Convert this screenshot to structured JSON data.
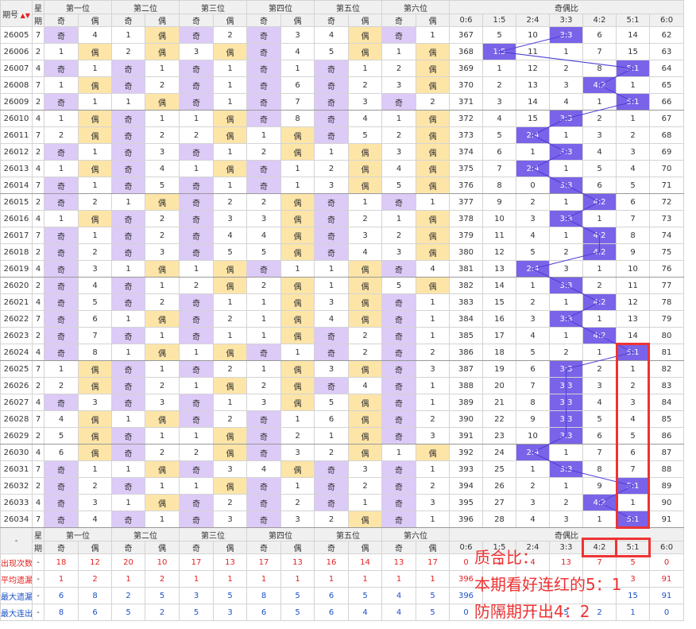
{
  "chart_data": {
    "type": "table",
    "header": {
      "issue": "期号",
      "week": [
        "星",
        "期"
      ],
      "positions": [
        "第一位",
        "第二位",
        "第三位",
        "第四位",
        "第五位",
        "第六位"
      ],
      "odd": "奇",
      "even": "偶",
      "ratio_group": "奇偶比",
      "ratios": [
        "0:6",
        "1:5",
        "2:4",
        "3:3",
        "4:2",
        "5:1",
        "6:0"
      ]
    },
    "rows": [
      {
        "issue": "26005",
        "week": "7",
        "pos": [
          "O",
          "E",
          "O",
          "O",
          "E",
          "O"
        ],
        "omit": [
          4,
          1,
          2,
          3,
          4,
          1
        ],
        "ratio": "3:3",
        "rmiss": [
          367,
          5,
          10,
          0,
          6,
          14,
          62
        ]
      },
      {
        "issue": "26006",
        "week": "2",
        "pos": [
          "E",
          "E",
          "E",
          "O",
          "E",
          "E"
        ],
        "omit": [
          1,
          2,
          3,
          4,
          5,
          1
        ],
        "ratio": "1:5",
        "rmiss": [
          368,
          0,
          11,
          1,
          7,
          15,
          63
        ]
      },
      {
        "issue": "26007",
        "week": "4",
        "pos": [
          "O",
          "O",
          "O",
          "O",
          "O",
          "E"
        ],
        "omit": [
          1,
          1,
          1,
          1,
          1,
          2
        ],
        "ratio": "5:1",
        "rmiss": [
          369,
          1,
          12,
          2,
          8,
          0,
          64
        ]
      },
      {
        "issue": "26008",
        "week": "7",
        "pos": [
          "E",
          "O",
          "O",
          "O",
          "O",
          "E"
        ],
        "omit": [
          1,
          2,
          1,
          6,
          2,
          3
        ],
        "ratio": "4:2",
        "rmiss": [
          370,
          2,
          13,
          3,
          0,
          1,
          65
        ]
      },
      {
        "issue": "26009",
        "week": "2",
        "pos": [
          "O",
          "E",
          "O",
          "O",
          "O",
          "O"
        ],
        "omit": [
          1,
          1,
          1,
          7,
          3,
          2
        ],
        "ratio": "5:1",
        "rmiss": [
          371,
          3,
          14,
          4,
          1,
          0,
          66
        ]
      },
      {
        "issue": "26010",
        "week": "4",
        "pos": [
          "E",
          "O",
          "E",
          "O",
          "O",
          "E"
        ],
        "omit": [
          1,
          1,
          1,
          8,
          4,
          1
        ],
        "ratio": "3:3",
        "rmiss": [
          372,
          4,
          15,
          0,
          2,
          1,
          67
        ]
      },
      {
        "issue": "26011",
        "week": "7",
        "pos": [
          "E",
          "O",
          "E",
          "E",
          "O",
          "E"
        ],
        "omit": [
          2,
          2,
          2,
          1,
          5,
          2
        ],
        "ratio": "2:4",
        "rmiss": [
          373,
          5,
          0,
          1,
          3,
          2,
          68
        ]
      },
      {
        "issue": "26012",
        "week": "2",
        "pos": [
          "O",
          "O",
          "O",
          "E",
          "E",
          "E"
        ],
        "omit": [
          1,
          3,
          1,
          2,
          1,
          3
        ],
        "ratio": "3:3",
        "rmiss": [
          374,
          6,
          1,
          0,
          4,
          3,
          69
        ]
      },
      {
        "issue": "26013",
        "week": "4",
        "pos": [
          "E",
          "O",
          "E",
          "O",
          "E",
          "E"
        ],
        "omit": [
          1,
          4,
          1,
          1,
          2,
          4
        ],
        "ratio": "2:4",
        "rmiss": [
          375,
          7,
          0,
          1,
          5,
          4,
          70
        ]
      },
      {
        "issue": "26014",
        "week": "7",
        "pos": [
          "O",
          "O",
          "O",
          "O",
          "E",
          "E"
        ],
        "omit": [
          1,
          5,
          1,
          1,
          3,
          5
        ],
        "ratio": "3:3",
        "rmiss": [
          376,
          8,
          0,
          1,
          6,
          5,
          71
        ]
      },
      {
        "issue": "26015",
        "week": "2",
        "pos": [
          "O",
          "E",
          "O",
          "E",
          "O",
          "O"
        ],
        "omit": [
          2,
          1,
          2,
          2,
          1,
          1
        ],
        "ratio": "4:2",
        "rmiss": [
          377,
          9,
          2,
          1,
          0,
          6,
          72
        ]
      },
      {
        "issue": "26016",
        "week": "4",
        "pos": [
          "E",
          "O",
          "O",
          "E",
          "O",
          "E"
        ],
        "omit": [
          1,
          2,
          3,
          3,
          2,
          1
        ],
        "ratio": "3:3",
        "rmiss": [
          378,
          10,
          3,
          0,
          1,
          7,
          73
        ]
      },
      {
        "issue": "26017",
        "week": "7",
        "pos": [
          "O",
          "O",
          "O",
          "E",
          "O",
          "E"
        ],
        "omit": [
          1,
          2,
          4,
          4,
          3,
          2
        ],
        "ratio": "4:2",
        "rmiss": [
          379,
          11,
          4,
          1,
          0,
          8,
          74
        ]
      },
      {
        "issue": "26018",
        "week": "2",
        "pos": [
          "O",
          "O",
          "O",
          "E",
          "O",
          "E"
        ],
        "omit": [
          2,
          3,
          5,
          5,
          4,
          3
        ],
        "ratio": "4:2",
        "rmiss": [
          380,
          12,
          5,
          2,
          0,
          9,
          75
        ]
      },
      {
        "issue": "26019",
        "week": "4",
        "pos": [
          "O",
          "E",
          "E",
          "O",
          "E",
          "O"
        ],
        "omit": [
          3,
          1,
          1,
          1,
          1,
          4
        ],
        "ratio": "2:4",
        "rmiss": [
          381,
          13,
          0,
          3,
          1,
          10,
          76
        ]
      },
      {
        "issue": "26020",
        "week": "2",
        "pos": [
          "O",
          "O",
          "E",
          "E",
          "E",
          "E"
        ],
        "omit": [
          4,
          1,
          2,
          2,
          1,
          5
        ],
        "ratio": "3:3",
        "rmiss": [
          382,
          14,
          1,
          0,
          2,
          11,
          77
        ]
      },
      {
        "issue": "26021",
        "week": "4",
        "pos": [
          "O",
          "O",
          "O",
          "E",
          "E",
          "O"
        ],
        "omit": [
          5,
          2,
          1,
          1,
          3,
          1
        ],
        "ratio": "4:2",
        "rmiss": [
          383,
          15,
          2,
          1,
          0,
          12,
          78
        ]
      },
      {
        "issue": "26022",
        "week": "7",
        "pos": [
          "O",
          "E",
          "O",
          "E",
          "E",
          "O"
        ],
        "omit": [
          6,
          1,
          2,
          1,
          4,
          1
        ],
        "ratio": "3:3",
        "rmiss": [
          384,
          16,
          3,
          0,
          1,
          13,
          79
        ]
      },
      {
        "issue": "26023",
        "week": "2",
        "pos": [
          "O",
          "O",
          "O",
          "E",
          "O",
          "O"
        ],
        "omit": [
          7,
          1,
          1,
          1,
          2,
          1
        ],
        "ratio": "4:2",
        "rmiss": [
          385,
          17,
          4,
          1,
          0,
          14,
          80
        ]
      },
      {
        "issue": "26024",
        "week": "4",
        "pos": [
          "O",
          "E",
          "E",
          "O",
          "O",
          "O"
        ],
        "omit": [
          8,
          1,
          1,
          1,
          2,
          2
        ],
        "ratio": "5:1",
        "rmiss": [
          386,
          18,
          5,
          2,
          1,
          0,
          81
        ]
      },
      {
        "issue": "26025",
        "week": "7",
        "pos": [
          "E",
          "O",
          "O",
          "E",
          "E",
          "O"
        ],
        "omit": [
          1,
          1,
          2,
          1,
          3,
          3
        ],
        "ratio": "3:3",
        "rmiss": [
          387,
          19,
          6,
          0,
          2,
          1,
          82
        ]
      },
      {
        "issue": "26026",
        "week": "2",
        "pos": [
          "E",
          "O",
          "E",
          "E",
          "O",
          "O"
        ],
        "omit": [
          2,
          2,
          1,
          2,
          4,
          1
        ],
        "ratio": "3:3",
        "rmiss": [
          388,
          20,
          7,
          0,
          3,
          2,
          83
        ]
      },
      {
        "issue": "26027",
        "week": "4",
        "pos": [
          "O",
          "O",
          "O",
          "E",
          "E",
          "O"
        ],
        "omit": [
          3,
          3,
          1,
          3,
          5,
          1
        ],
        "ratio": "3:3",
        "rmiss": [
          389,
          21,
          8,
          0,
          4,
          3,
          84
        ]
      },
      {
        "issue": "26028",
        "week": "7",
        "pos": [
          "E",
          "E",
          "O",
          "O",
          "E",
          "O"
        ],
        "omit": [
          4,
          1,
          2,
          1,
          6,
          2
        ],
        "ratio": "3:3",
        "rmiss": [
          390,
          22,
          9,
          0,
          5,
          4,
          85
        ]
      },
      {
        "issue": "26029",
        "week": "2",
        "pos": [
          "E",
          "O",
          "E",
          "O",
          "E",
          "O"
        ],
        "omit": [
          5,
          1,
          1,
          2,
          1,
          3
        ],
        "ratio": "3:3",
        "rmiss": [
          391,
          23,
          10,
          0,
          6,
          5,
          86
        ]
      },
      {
        "issue": "26030",
        "week": "4",
        "pos": [
          "E",
          "O",
          "E",
          "O",
          "E",
          "E"
        ],
        "omit": [
          6,
          2,
          2,
          3,
          2,
          1
        ],
        "ratio": "2:4",
        "rmiss": [
          392,
          24,
          0,
          1,
          7,
          6,
          87
        ]
      },
      {
        "issue": "26031",
        "week": "7",
        "pos": [
          "O",
          "E",
          "O",
          "E",
          "O",
          "O"
        ],
        "omit": [
          1,
          1,
          3,
          4,
          3,
          1
        ],
        "ratio": "3:3",
        "rmiss": [
          393,
          25,
          1,
          0,
          8,
          7,
          88
        ]
      },
      {
        "issue": "26032",
        "week": "2",
        "pos": [
          "O",
          "O",
          "E",
          "O",
          "O",
          "O"
        ],
        "omit": [
          2,
          1,
          1,
          1,
          2,
          2
        ],
        "ratio": "5:1",
        "rmiss": [
          394,
          26,
          2,
          1,
          9,
          0,
          89
        ]
      },
      {
        "issue": "26033",
        "week": "4",
        "pos": [
          "O",
          "E",
          "O",
          "O",
          "O",
          "O"
        ],
        "omit": [
          3,
          1,
          2,
          2,
          1,
          3
        ],
        "ratio": "4:2",
        "rmiss": [
          395,
          27,
          3,
          2,
          0,
          1,
          90
        ]
      },
      {
        "issue": "26034",
        "week": "7",
        "pos": [
          "O",
          "O",
          "O",
          "O",
          "E",
          "O"
        ],
        "omit": [
          4,
          1,
          3,
          3,
          2,
          1
        ],
        "ratio": "5:1",
        "rmiss": [
          396,
          28,
          4,
          3,
          1,
          0,
          91
        ]
      }
    ],
    "stats": [
      {
        "label": "出现次数",
        "dash": "-",
        "values": [
          "18",
          "12",
          "20",
          "10",
          "17",
          "13",
          "17",
          "13",
          "16",
          "14",
          "13",
          "17"
        ],
        "rvalues": [
          "0",
          "1",
          "4",
          "13",
          "7",
          "5",
          "0"
        ],
        "color": "red"
      },
      {
        "label": "平均遗漏",
        "dash": "-",
        "values": [
          "1",
          "2",
          "1",
          "2",
          "1",
          "1",
          "1",
          "1",
          "1",
          "1",
          "1",
          "1"
        ],
        "rvalues": [
          "396",
          "",
          "",
          "",
          "",
          "3",
          "91"
        ],
        "color": "red"
      },
      {
        "label": "最大遗漏",
        "dash": "-",
        "values": [
          "6",
          "8",
          "2",
          "5",
          "3",
          "5",
          "8",
          "5",
          "6",
          "5",
          "4",
          "5"
        ],
        "rvalues": [
          "396",
          "",
          "",
          "",
          "",
          "15",
          "91"
        ],
        "color": "blue"
      },
      {
        "label": "最大连出",
        "dash": "-",
        "values": [
          "8",
          "6",
          "5",
          "2",
          "5",
          "3",
          "6",
          "5",
          "6",
          "4",
          "4",
          "5"
        ],
        "rvalues": [
          "0",
          "1",
          "1",
          "5",
          "2",
          "1",
          "0"
        ],
        "color": "blue"
      }
    ],
    "note": [
      "质合比：",
      "本期看好连红的5：1",
      "防隔期开出4：2"
    ]
  }
}
